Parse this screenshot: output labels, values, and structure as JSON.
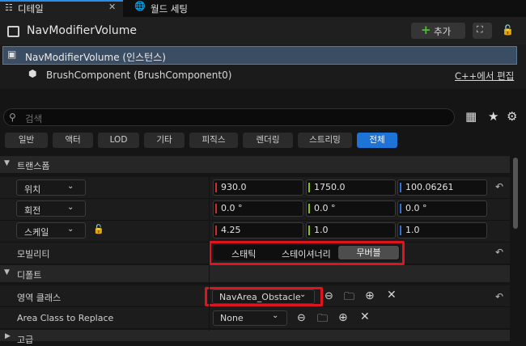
{
  "tabs": [
    {
      "label": "디테일"
    },
    {
      "label": "월드 세팅"
    }
  ],
  "header": {
    "title": "NavModifierVolume",
    "add_label": "추가"
  },
  "tree": {
    "root": "NavModifierVolume (인스턴스)",
    "child": "BrushComponent (BrushComponent0)",
    "edit_link": "C++에서 편집"
  },
  "search": {
    "placeholder": "검색"
  },
  "filters": [
    "일반",
    "액터",
    "LOD",
    "기타",
    "피직스",
    "렌더링",
    "스트리밍",
    "전체"
  ],
  "transform": {
    "section": "트랜스폼",
    "location": {
      "label": "위치",
      "x": "930.0",
      "y": "1750.0",
      "z": "100.06261"
    },
    "rotation": {
      "label": "회전",
      "x": "0.0 °",
      "y": "0.0 °",
      "z": "0.0 °"
    },
    "scale": {
      "label": "스케일",
      "x": "4.25",
      "y": "1.0",
      "z": "1.0"
    },
    "mobility": {
      "label": "모빌리티",
      "options": [
        "스태틱",
        "스테이셔너리",
        "무버블"
      ],
      "selected": "무버블"
    }
  },
  "default": {
    "section": "디폴트",
    "area_class": {
      "label": "영역 클래스",
      "value": "NavArea_Obstacle"
    },
    "area_replace": {
      "label": "Area Class to Replace",
      "value": "None"
    }
  },
  "advanced": {
    "section": "고급"
  },
  "colors": {
    "accent": "#2a8ee8",
    "selected_filter": "#1e74d6",
    "highlight": "#e0141e",
    "x_axis": "#c9302c",
    "y_axis": "#8abf1a",
    "z_axis": "#2f73d8"
  }
}
